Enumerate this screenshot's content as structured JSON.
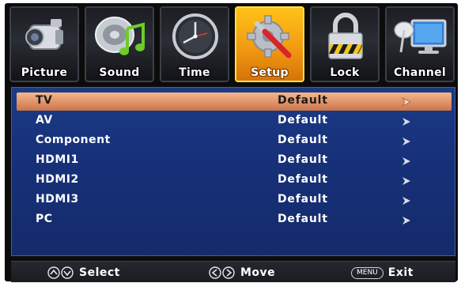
{
  "tabs": [
    {
      "id": "picture",
      "label": "Picture",
      "icon": "camcorder-icon",
      "active": false
    },
    {
      "id": "sound",
      "label": "Sound",
      "icon": "speaker-music-note-icon",
      "active": false
    },
    {
      "id": "time",
      "label": "Time",
      "icon": "clock-icon",
      "active": false
    },
    {
      "id": "setup",
      "label": "Setup",
      "icon": "gear-tools-icon",
      "active": true
    },
    {
      "id": "lock",
      "label": "Lock",
      "icon": "padlock-icon",
      "active": false
    },
    {
      "id": "channel",
      "label": "Channel",
      "icon": "satellite-monitor-icon",
      "active": false
    }
  ],
  "list": {
    "selected_index": 0,
    "rows": [
      {
        "name": "TV",
        "value": "Default"
      },
      {
        "name": "AV",
        "value": "Default"
      },
      {
        "name": "Component",
        "value": "Default"
      },
      {
        "name": "HDMI1",
        "value": "Default"
      },
      {
        "name": "HDMI2",
        "value": "Default"
      },
      {
        "name": "HDMI3",
        "value": "Default"
      },
      {
        "name": "PC",
        "value": "Default"
      }
    ]
  },
  "footer": {
    "select_label": "Select",
    "move_label": "Move",
    "menu_key": "MENU",
    "exit_label": "Exit"
  },
  "colors": {
    "active_tab": "#f29a12",
    "panel_blue": "#17317a",
    "selected_row": "#e2956a"
  }
}
